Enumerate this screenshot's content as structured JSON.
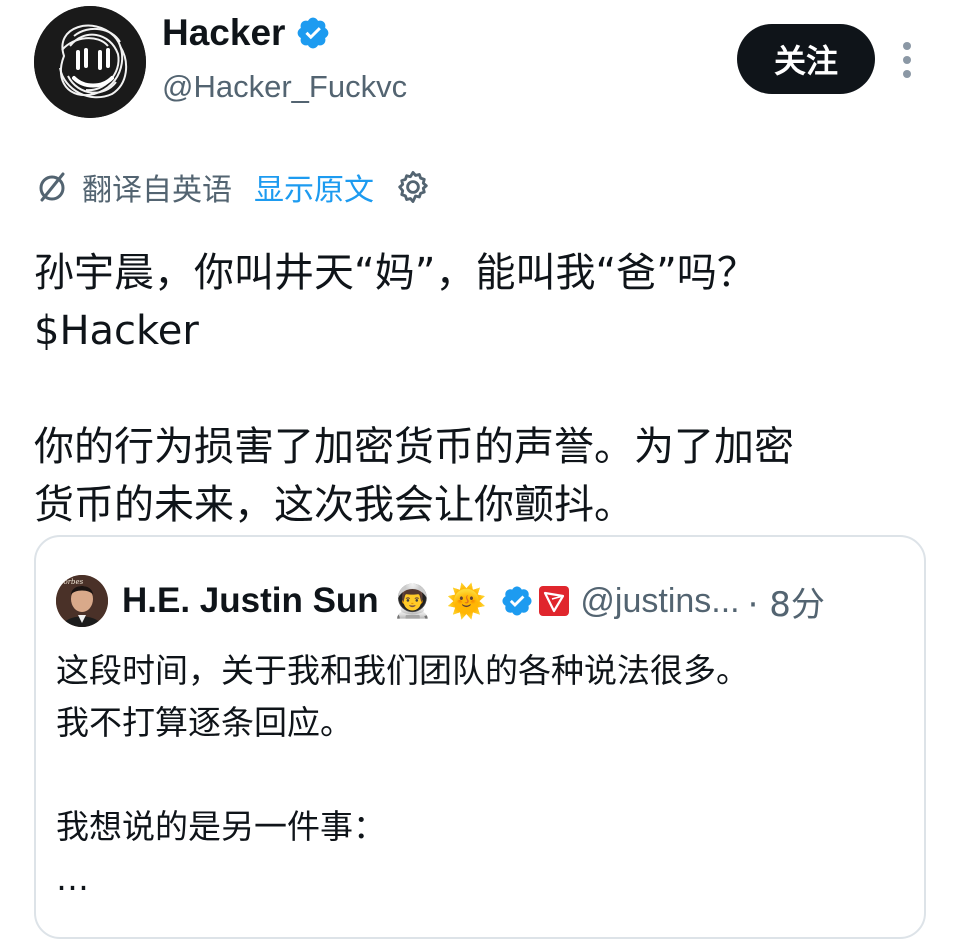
{
  "author": {
    "display_name": "Hacker",
    "handle": "@Hacker_Fuckvc",
    "verified": true,
    "avatar_icon": "scribble-face-avatar"
  },
  "actions": {
    "follow_label": "关注",
    "more_icon": "more-vertical-icon"
  },
  "translation": {
    "translated_from": "翻译自英语",
    "show_original": "显示原文",
    "settings_icon": "gear-icon"
  },
  "tweet": {
    "text": "孙宇晨，你叫井天“妈”，能叫我“爸”吗？\n$Hacker\n\n你的行为损害了加密货币的声誉。为了加密\n货币的未来，这次我会让你颤抖。"
  },
  "quoted_tweet": {
    "display_name": "H.E. Justin Sun",
    "emojis": [
      "👨‍🚀",
      "🌞"
    ],
    "handle": "@justins...",
    "time": "· 8分",
    "text": "这段时间，关于我和我们团队的各种说法很多。\n我不打算逐条回应。\n\n我想说的是另一件事：\n…",
    "avatar_icon": "profile-photo-avatar"
  },
  "colors": {
    "text": "#0f1419",
    "muted": "#536471",
    "link": "#1d9bf0",
    "verified": "#1d9bf0",
    "button_bg": "#0f1419",
    "card_border": "#dde3e8",
    "tron_red": "#e0262d"
  }
}
